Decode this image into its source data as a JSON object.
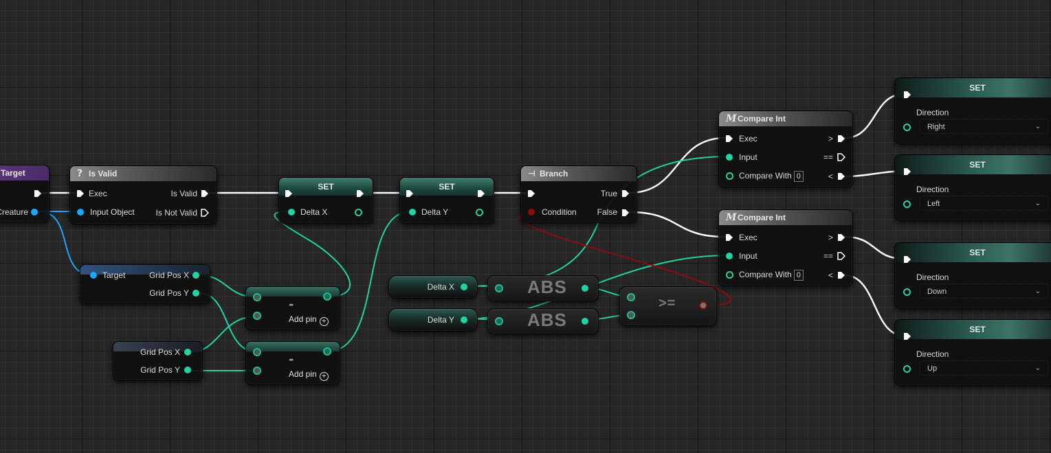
{
  "nodes": {
    "get_target": {
      "title": "Target",
      "pin_out": "Creature"
    },
    "is_valid": {
      "title": "Is Valid",
      "exec_in": "Exec",
      "input_object": "Input Object",
      "valid_out": "Is Valid",
      "not_valid_out": "Is Not Valid"
    },
    "set_delta_x": {
      "title": "SET",
      "pin": "Delta X"
    },
    "set_delta_y": {
      "title": "SET",
      "pin": "Delta Y"
    },
    "branch": {
      "title": "Branch",
      "condition": "Condition",
      "true_out": "True",
      "false_out": "False"
    },
    "get_target_grid": {
      "target": "Target",
      "grid_x": "Grid Pos X",
      "grid_y": "Grid Pos Y"
    },
    "grid_pos_var": {
      "grid_x": "Grid Pos X",
      "grid_y": "Grid Pos Y"
    },
    "subtract_1": {
      "symbol": "-",
      "add_pin": "Add pin"
    },
    "subtract_2": {
      "symbol": "-",
      "add_pin": "Add pin"
    },
    "get_delta_x": {
      "label": "Delta X"
    },
    "get_delta_y": {
      "label": "Delta Y"
    },
    "abs_1": {
      "label": "ABS"
    },
    "abs_2": {
      "label": "ABS"
    },
    "gte": {
      "label": ">="
    },
    "compare_int_1": {
      "title": "Compare Int",
      "exec": "Exec",
      "input": "Input",
      "compare_with": "Compare With",
      "compare_value": "0",
      "gt": ">",
      "eq": "==",
      "lt": "<"
    },
    "compare_int_2": {
      "title": "Compare Int",
      "exec": "Exec",
      "input": "Input",
      "compare_with": "Compare With",
      "compare_value": "0",
      "gt": ">",
      "eq": "==",
      "lt": "<"
    },
    "set_dir_1": {
      "title": "SET",
      "label": "Direction",
      "value": "Right"
    },
    "set_dir_2": {
      "title": "SET",
      "label": "Direction",
      "value": "Left"
    },
    "set_dir_3": {
      "title": "SET",
      "label": "Direction",
      "value": "Down"
    },
    "set_dir_4": {
      "title": "SET",
      "label": "Direction",
      "value": "Up"
    }
  },
  "colors": {
    "exec_wire": "#ffffff",
    "int_wire": "#21d3a4",
    "object_wire": "#1aa7ff",
    "bool_wire": "#8a0d0d"
  },
  "icons": {
    "is_valid": "question-mark-icon",
    "branch": "branch-icon",
    "compare_int": "macro-m-icon",
    "dropdown": "chevron-down-icon",
    "add_pin": "plus-circle-icon"
  }
}
